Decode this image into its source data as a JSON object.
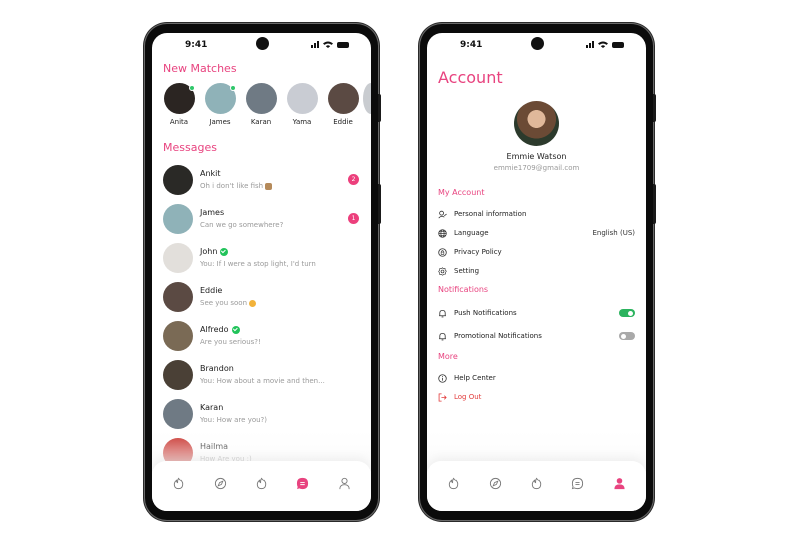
{
  "colors": {
    "accent": "#e8437f",
    "badge": "#ec3f7c",
    "online": "#2fc76a",
    "verified": "#21c35a",
    "toggle_on": "#2bb35e",
    "toggle_off": "#a9a9a9",
    "logout": "#e23b3b"
  },
  "left_phone": {
    "status_time": "9:41",
    "new_matches_title": "New Matches",
    "matches": [
      {
        "name": "Anita",
        "online": true,
        "avatar_color": "#2b2522"
      },
      {
        "name": "James",
        "online": true,
        "avatar_color": "#8fb2b8"
      },
      {
        "name": "Karan",
        "online": false,
        "avatar_color": "#6f7a84"
      },
      {
        "name": "Yama",
        "online": false,
        "avatar_color": "#c9ccd3"
      },
      {
        "name": "Eddie",
        "online": false,
        "avatar_color": "#5b4a43"
      }
    ],
    "messages_title": "Messages",
    "messages": [
      {
        "name": "Ankit",
        "preview": "Oh i don't like fish",
        "emoji": "monkey-emoji",
        "unread": "2",
        "verified": false,
        "avatar_color": "#2a2926"
      },
      {
        "name": "James",
        "preview": "Can we go somewhere?",
        "emoji": null,
        "unread": "1",
        "verified": false,
        "avatar_color": "#8fb2b8"
      },
      {
        "name": "John",
        "preview": "You: If I were a stop light, I'd turn",
        "emoji": null,
        "unread": null,
        "verified": true,
        "avatar_color": "#e2dfdb"
      },
      {
        "name": "Eddie",
        "preview": "See you soon",
        "emoji": "smirk-emoji",
        "unread": null,
        "verified": false,
        "avatar_color": "#5b4a43"
      },
      {
        "name": "Alfredo",
        "preview": "Are you serious?!",
        "emoji": null,
        "unread": null,
        "verified": true,
        "avatar_color": "#7a6a55"
      },
      {
        "name": "Brandon",
        "preview": "You: How about a movie and then...",
        "emoji": null,
        "unread": null,
        "verified": false,
        "avatar_color": "#4a4036"
      },
      {
        "name": "Karan",
        "preview": "You: How are you?)",
        "emoji": null,
        "unread": null,
        "verified": false,
        "avatar_color": "#6f7a84"
      },
      {
        "name": "Hailma",
        "preview": "How Are you :)",
        "emoji": null,
        "unread": null,
        "verified": false,
        "avatar_color": "#c8312b"
      }
    ],
    "nav": [
      {
        "icon": "flame-icon",
        "active": false
      },
      {
        "icon": "compass-icon",
        "active": false
      },
      {
        "icon": "flame-icon",
        "active": false
      },
      {
        "icon": "chat-icon",
        "active": true
      },
      {
        "icon": "profile-icon",
        "active": false
      }
    ]
  },
  "right_phone": {
    "status_time": "9:41",
    "title": "Account",
    "profile": {
      "name": "Emmie Watson",
      "email": "emmie1709@gmail.com"
    },
    "sections": {
      "my_account": {
        "title": "My Account",
        "items": [
          {
            "label": "Personal information",
            "icon": "user-edit-icon",
            "value": ""
          },
          {
            "label": "Language",
            "icon": "globe-icon",
            "value": "English (US)"
          },
          {
            "label": "Privacy Policy",
            "icon": "privacy-icon",
            "value": ""
          },
          {
            "label": "Setting",
            "icon": "gear-icon",
            "value": ""
          }
        ]
      },
      "notifications": {
        "title": "Notifications",
        "items": [
          {
            "label": "Push Notifications",
            "icon": "bell-icon",
            "enabled": true
          },
          {
            "label": "Promotional Notifications",
            "icon": "bell-icon",
            "enabled": false
          }
        ]
      },
      "more": {
        "title": "More",
        "items": [
          {
            "label": "Help Center",
            "icon": "info-icon"
          },
          {
            "label": "Log Out",
            "icon": "logout-icon"
          }
        ]
      }
    },
    "nav": [
      {
        "icon": "flame-icon",
        "active": false
      },
      {
        "icon": "compass-icon",
        "active": false
      },
      {
        "icon": "flame-icon",
        "active": false
      },
      {
        "icon": "chat-icon",
        "active": false
      },
      {
        "icon": "profile-icon",
        "active": true
      }
    ]
  }
}
